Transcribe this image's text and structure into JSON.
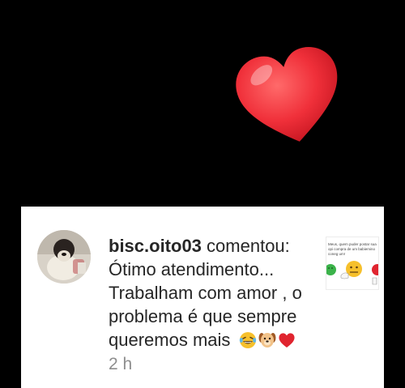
{
  "heart_icon": "heart-icon",
  "notification": {
    "username": "bisc.oito03",
    "action": "comentou:",
    "comment_lines": [
      "Ótimo atendimento...",
      "Trabalham com amor , o",
      "problema é que sempre",
      "queremos mais"
    ],
    "emojis": [
      "laughing-tears-emoji-icon",
      "dog-face-emoji-icon",
      "red-heart-emoji-icon"
    ],
    "time": "2 h"
  },
  "thumbnail": {
    "text": "Meus, quem puder postar sua opi compra de um babiemino coneg um!",
    "icons": [
      "green-face-icon",
      "yellow-face-icon",
      "red-face-icon"
    ]
  },
  "colors": {
    "background": "#000000",
    "card": "#ffffff",
    "text": "#262626",
    "time": "#8e8e8e",
    "heart": "#e8242f"
  }
}
